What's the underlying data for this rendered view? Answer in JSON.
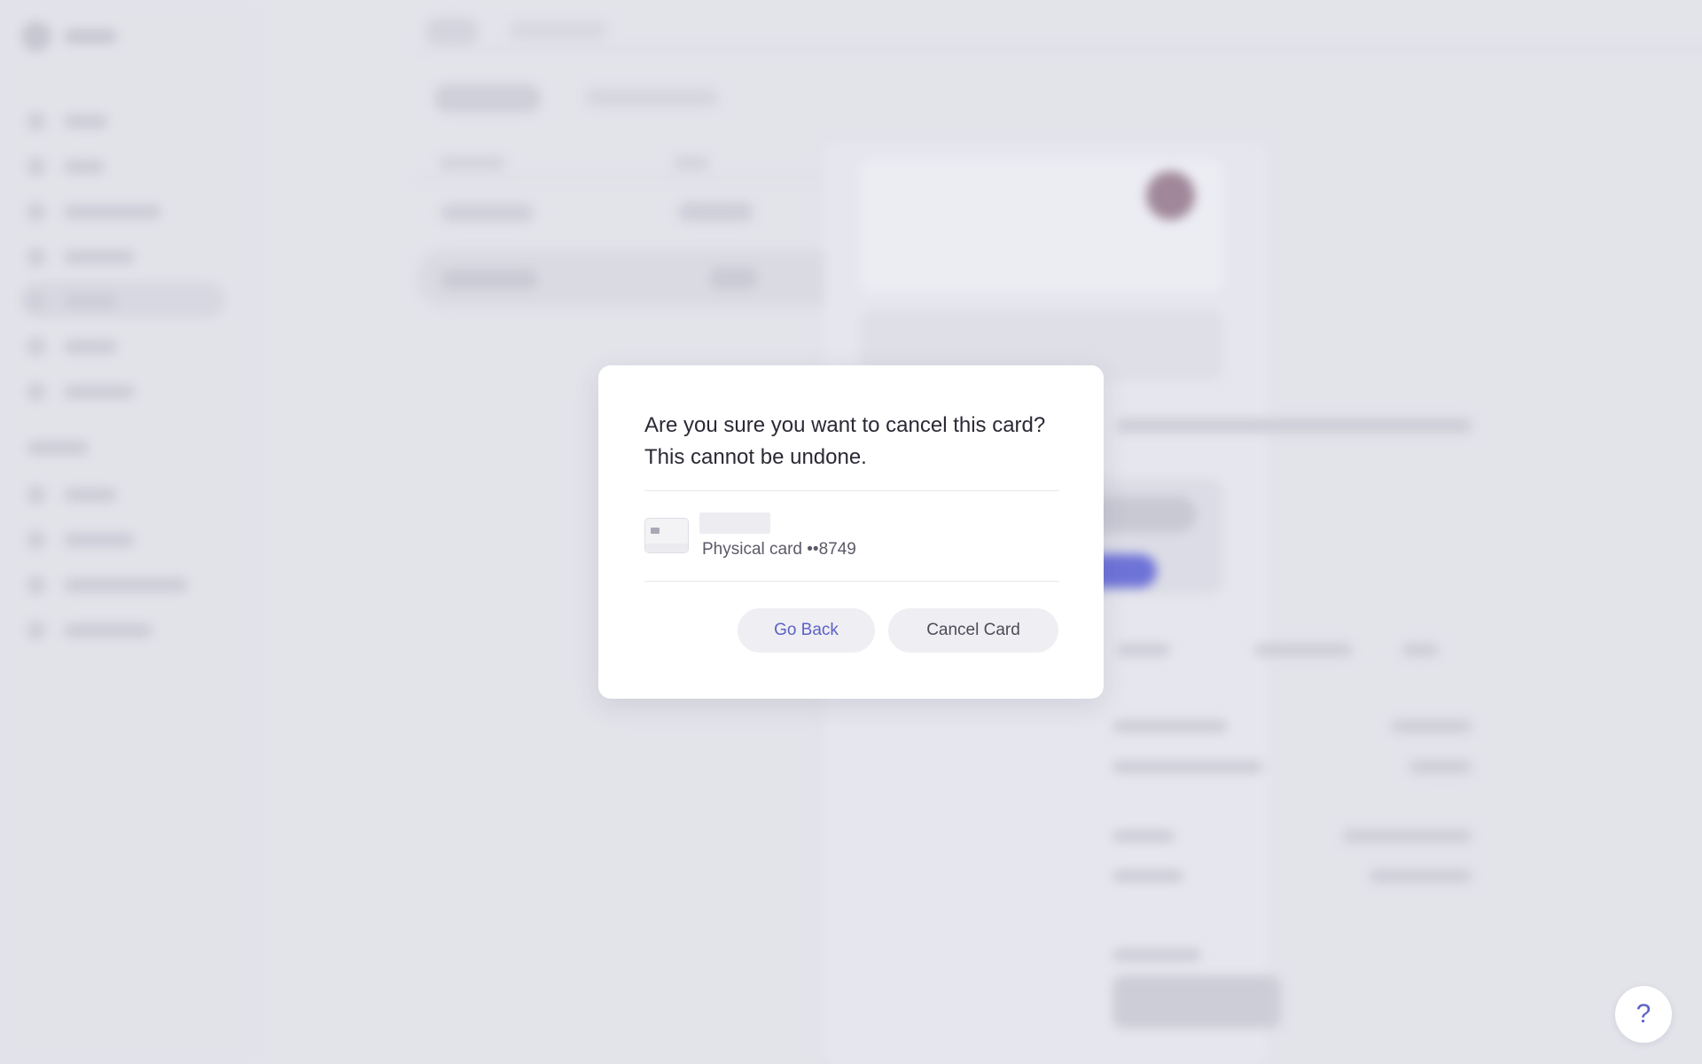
{
  "modal": {
    "title": "Are you sure you want to cancel this card? This cannot be undone.",
    "card_label": "Physical card ••8749",
    "go_back_label": "Go Back",
    "cancel_card_label": "Cancel Card"
  },
  "help": {
    "label": "?"
  },
  "colors": {
    "accent": "#5c62c4",
    "overlay": "#e3e3ea",
    "cta": "#6e73d8"
  },
  "icons": {
    "card": "credit-card-icon",
    "help": "question-mark-icon"
  }
}
